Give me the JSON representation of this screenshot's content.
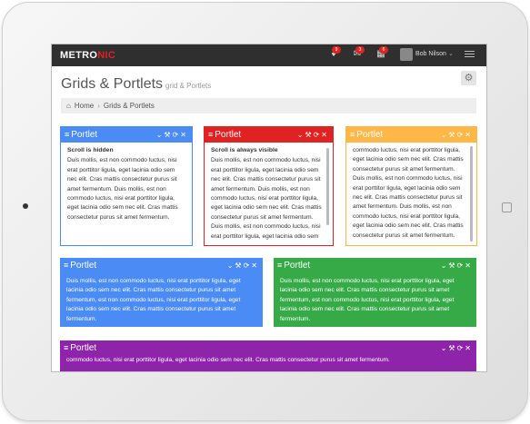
{
  "app": {
    "logo_main": "METRO",
    "logo_accent": "NIC"
  },
  "topbar": {
    "badges": [
      "9",
      "3",
      "6"
    ],
    "user_name": "Bob Nilson",
    "icons": [
      "bell-icon",
      "envelope-icon",
      "calendar-icon",
      "caret-down-icon",
      "hamburger-menu-icon"
    ]
  },
  "page": {
    "title": "Grids & Portlets",
    "subtitle": "grid & Portlets"
  },
  "breadcrumb": {
    "home": "Home",
    "current": "Grids & Portlets"
  },
  "colors": {
    "blue": "#4a8bf5",
    "red": "#e02222",
    "yellow": "#ffb848",
    "green": "#35aa47",
    "purple": "#8e24aa"
  },
  "portlets": [
    {
      "title": "Portlet",
      "heading": "Scroll is hidden",
      "text": "Duis mollis, est non commodo luctus, nisi erat porttitor ligula, eget lacinia odio sem nec elit. Cras mattis consectetur purus sit amet fermentum. Duis mollis, est non commodo luctus, nisi erat porttitor ligula, eget lacinia odio sem nec elit. Cras mattis consectetur purus sit amet fermentum."
    },
    {
      "title": "Portlet",
      "heading": "Scroll is always visible",
      "text": "Duis mollis, est non commodo luctus, nisi erat porttitor ligula, eget lacinia odio sem nec elit. Cras mattis consectetur purus sit amet fermentum. Duis mollis, est non commodo luctus, nisi erat porttitor ligula, eget lacinia odio sem nec elit. Cras mattis consectetur purus sit amet fermentum. Duis mollis, est non commodo luctus, nisi erat porttitor ligula, eget lacinia odio sem nec elit. Cras mattis consectetur purus sit amet fermentum."
    },
    {
      "title": "Portlet",
      "heading": "",
      "text": "commodo luctus, nisi erat porttitor ligula, eget lacinia odio sem nec elit. Cras mattis consectetur purus sit amet fermentum. Duis mollis, est non commodo luctus, nisi erat porttitor ligula, eget lacinia odio sem nec elit. Cras mattis consectetur purus sit amet fermentum. Duis mollis, est non commodo luctus, nisi erat porttitor ligula, eget lacinia odio sem nec elit. Cras mattis consectetur purus sit amet fermentum."
    },
    {
      "title": "Portlet",
      "heading": "",
      "text": "Duis mollis, est non commodo luctus, nisi erat porttitor ligula, eget lacinia odio sem nec elit. Cras mattis consectetur purus sit amet fermentum, est non commodo luctus, nisi erat porttitor ligula, eget lacinia odio sem nec elit. Cras mattis consectetur purus sit amet fermentum."
    },
    {
      "title": "Portlet",
      "heading": "",
      "text": "Duis mollis, est non commodo luctus, nisi erat porttitor ligula, eget lacinia odio sem nec elit. Cras mattis consectetur purus sit amet fermentum, est non commodo luctus, nisi erat porttitor ligula, eget lacinia odio sem nec elit. Cras mattis consectetur purus sit amet fermentum."
    },
    {
      "title": "Portlet",
      "heading": "",
      "text": "commodo luctus, nisi erat porttitor ligula, eget lacinia odio sem nec elit. Cras mattis consectetur purus sit amet fermentum."
    }
  ]
}
